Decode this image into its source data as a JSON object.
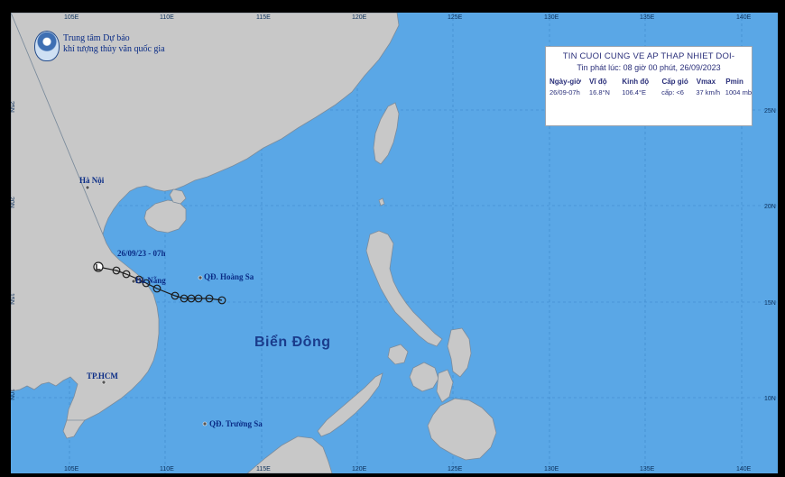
{
  "map": {
    "colors": {
      "sea": "#5aa7e6",
      "land": "#c8c8c8",
      "coast": "#7c8c9c",
      "track": "#222222",
      "label": "#0a2c86"
    },
    "lon_ticks": [
      "105E",
      "110E",
      "115E",
      "120E",
      "125E",
      "130E",
      "135E",
      "140E"
    ],
    "lat_ticks": [
      "25N",
      "20N",
      "15N",
      "10N"
    ],
    "places": [
      {
        "name": "Hà Nội"
      },
      {
        "name": "Đà Nẵng"
      },
      {
        "name": "QĐ. Hoàng Sa"
      },
      {
        "name": "TP.HCM"
      },
      {
        "name": "QĐ. Trường Sa"
      }
    ],
    "region_label": "Biển Đông",
    "track_label": "26/09/23 - 07h",
    "logo": {
      "icon": "weather-agency-emblem",
      "line1": "Trung tâm Dự báo",
      "line2": "khí tượng thủy văn quốc gia"
    }
  },
  "bulletin": {
    "title": "TIN CUOI CUNG VE AP THAP NHIET DOI-",
    "issued": "Tin phát lúc: 08 giờ 00 phút, 26/09/2023",
    "headers": [
      "Ngày-giờ",
      "Vĩ độ",
      "Kinh độ",
      "Cấp gió",
      "Vmax",
      "Pmin"
    ],
    "rows": [
      [
        "26/09-07h",
        "16.8°N",
        "106.4°E",
        "cấp: <6",
        "37 km/h",
        "1004 mb"
      ]
    ]
  }
}
